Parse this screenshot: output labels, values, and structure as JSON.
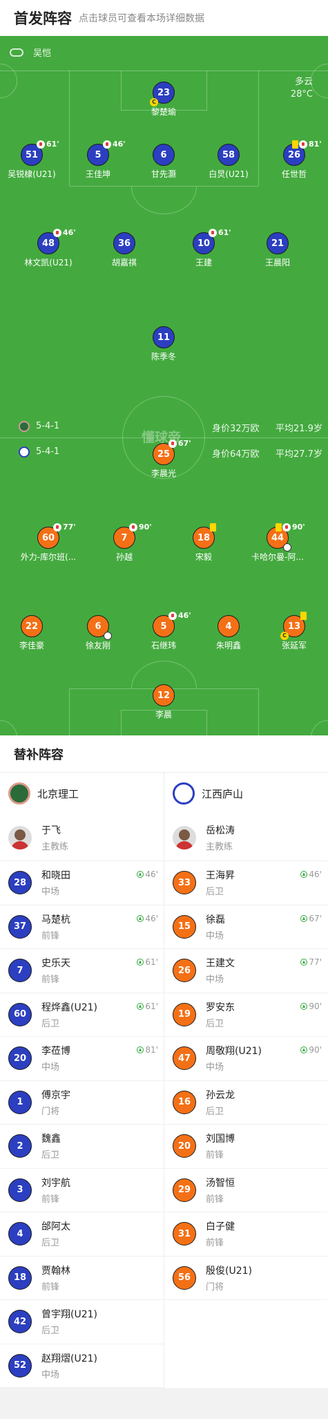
{
  "header": {
    "title": "首发阵容",
    "subtitle": "点击球员可查看本场详细数据"
  },
  "pitch": {
    "referee": "吴恺",
    "weather": "多云",
    "temperature": "28°C",
    "watermark": "懂球帝",
    "home": {
      "formation": "5-4-1",
      "value": "身价32万欧",
      "age": "平均21.9岁",
      "color": "#2b3fc0"
    },
    "away": {
      "formation": "5-4-1",
      "value": "身价64万欧",
      "age": "平均27.7岁",
      "color": "#f47016"
    }
  },
  "players": [
    {
      "num": "23",
      "name": "黎楚瑜",
      "team": "home",
      "captain": "C"
    },
    {
      "num": "51",
      "name": "吴锐棣(U21)",
      "team": "home",
      "sub_min": "61'"
    },
    {
      "num": "5",
      "name": "王佳坤",
      "team": "home",
      "sub_min": "46'"
    },
    {
      "num": "6",
      "name": "甘先灏",
      "team": "home"
    },
    {
      "num": "58",
      "name": "白炅(U21)",
      "team": "home"
    },
    {
      "num": "26",
      "name": "任世哲",
      "team": "home",
      "sub_min": "81'",
      "yellow": true
    },
    {
      "num": "48",
      "name": "林文凯(U21)",
      "team": "home",
      "sub_min": "46'"
    },
    {
      "num": "36",
      "name": "胡嘉祺",
      "team": "home"
    },
    {
      "num": "10",
      "name": "王建",
      "team": "home",
      "sub_min": "61'"
    },
    {
      "num": "21",
      "name": "王晨阳",
      "team": "home"
    },
    {
      "num": "11",
      "name": "陈季冬",
      "team": "home"
    },
    {
      "num": "25",
      "name": "李晨光",
      "team": "away",
      "sub_min": "67'"
    },
    {
      "num": "60",
      "name": "外力-库尔班(...",
      "team": "away",
      "sub_min": "77'"
    },
    {
      "num": "7",
      "name": "孙越",
      "team": "away",
      "sub_min": "90'"
    },
    {
      "num": "18",
      "name": "宋毅",
      "team": "away",
      "yellow": true
    },
    {
      "num": "44",
      "name": "卡哈尔曼-阿...",
      "team": "away",
      "sub_min": "90'",
      "yellow": true,
      "goal": true
    },
    {
      "num": "22",
      "name": "李佳豪",
      "team": "away"
    },
    {
      "num": "6",
      "name": "徐友刚",
      "team": "away",
      "goal": true
    },
    {
      "num": "5",
      "name": "石继玮",
      "team": "away",
      "sub_min": "46'"
    },
    {
      "num": "4",
      "name": "朱明鑫",
      "team": "away"
    },
    {
      "num": "13",
      "name": "张延军",
      "team": "away",
      "captain": "C",
      "yellow": true
    },
    {
      "num": "12",
      "name": "李晨",
      "team": "away"
    }
  ],
  "bench": {
    "title": "替补阵容",
    "home": {
      "team": "北京理工",
      "coach": {
        "name": "于飞",
        "role": "主教练"
      },
      "subs": [
        {
          "num": "28",
          "name": "和晓田",
          "pos": "中场",
          "min": "46'"
        },
        {
          "num": "37",
          "name": "马楚杭",
          "pos": "前锋",
          "min": "46'"
        },
        {
          "num": "7",
          "name": "史乐天",
          "pos": "前锋",
          "min": "61'"
        },
        {
          "num": "60",
          "name": "程烨鑫(U21)",
          "pos": "后卫",
          "min": "61'"
        },
        {
          "num": "20",
          "name": "李莅博",
          "pos": "中场",
          "min": "81'"
        },
        {
          "num": "1",
          "name": "傅京宇",
          "pos": "门将"
        },
        {
          "num": "2",
          "name": "魏鑫",
          "pos": "后卫"
        },
        {
          "num": "3",
          "name": "刘宇航",
          "pos": "前锋"
        },
        {
          "num": "4",
          "name": "邰阿太",
          "pos": "后卫"
        },
        {
          "num": "18",
          "name": "贾翰林",
          "pos": "前锋"
        },
        {
          "num": "42",
          "name": "曾宇翔(U21)",
          "pos": "后卫"
        },
        {
          "num": "52",
          "name": "赵翔熠(U21)",
          "pos": "中场"
        }
      ]
    },
    "away": {
      "team": "江西庐山",
      "coach": {
        "name": "岳松涛",
        "role": "主教练"
      },
      "subs": [
        {
          "num": "33",
          "name": "王海昇",
          "pos": "后卫",
          "min": "46'"
        },
        {
          "num": "15",
          "name": "徐磊",
          "pos": "中场",
          "min": "67'"
        },
        {
          "num": "26",
          "name": "王建文",
          "pos": "中场",
          "min": "77'"
        },
        {
          "num": "19",
          "name": "罗安东",
          "pos": "后卫",
          "min": "90'"
        },
        {
          "num": "47",
          "name": "周敬翔(U21)",
          "pos": "中场",
          "min": "90'"
        },
        {
          "num": "16",
          "name": "孙云龙",
          "pos": "后卫"
        },
        {
          "num": "20",
          "name": "刘国博",
          "pos": "前锋"
        },
        {
          "num": "29",
          "name": "汤智恒",
          "pos": "前锋"
        },
        {
          "num": "31",
          "name": "白子健",
          "pos": "前锋"
        },
        {
          "num": "56",
          "name": "殷俊(U21)",
          "pos": "门将"
        }
      ]
    }
  }
}
